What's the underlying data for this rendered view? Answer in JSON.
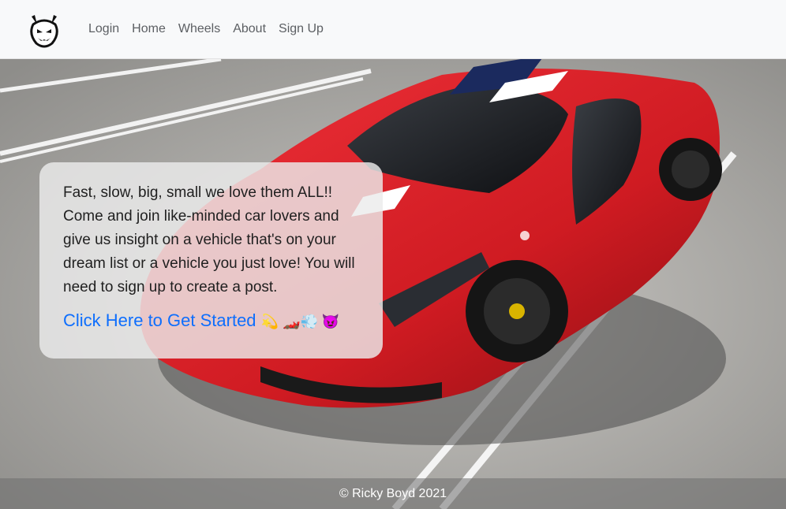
{
  "navbar": {
    "logo_icon": "devil-logo-icon",
    "links": [
      "Login",
      "Home",
      "Wheels",
      "About",
      "Sign Up"
    ]
  },
  "card": {
    "text": "Fast, slow, big, small we love them ALL!! Come and join like-minded car lovers and give us insight on a vehicle that's on your dream list or a vehicle you just love! You will need to sign up to create a post.",
    "cta_label": "Click Here to Get Started",
    "cta_emojis": "💫 🏎️💨 😈"
  },
  "footer": {
    "copyright": "© Ricky Boyd 2021"
  },
  "colors": {
    "accent": "#0d6efd",
    "car_red": "#d81f26",
    "navbar_bg": "#f8f9fa"
  }
}
